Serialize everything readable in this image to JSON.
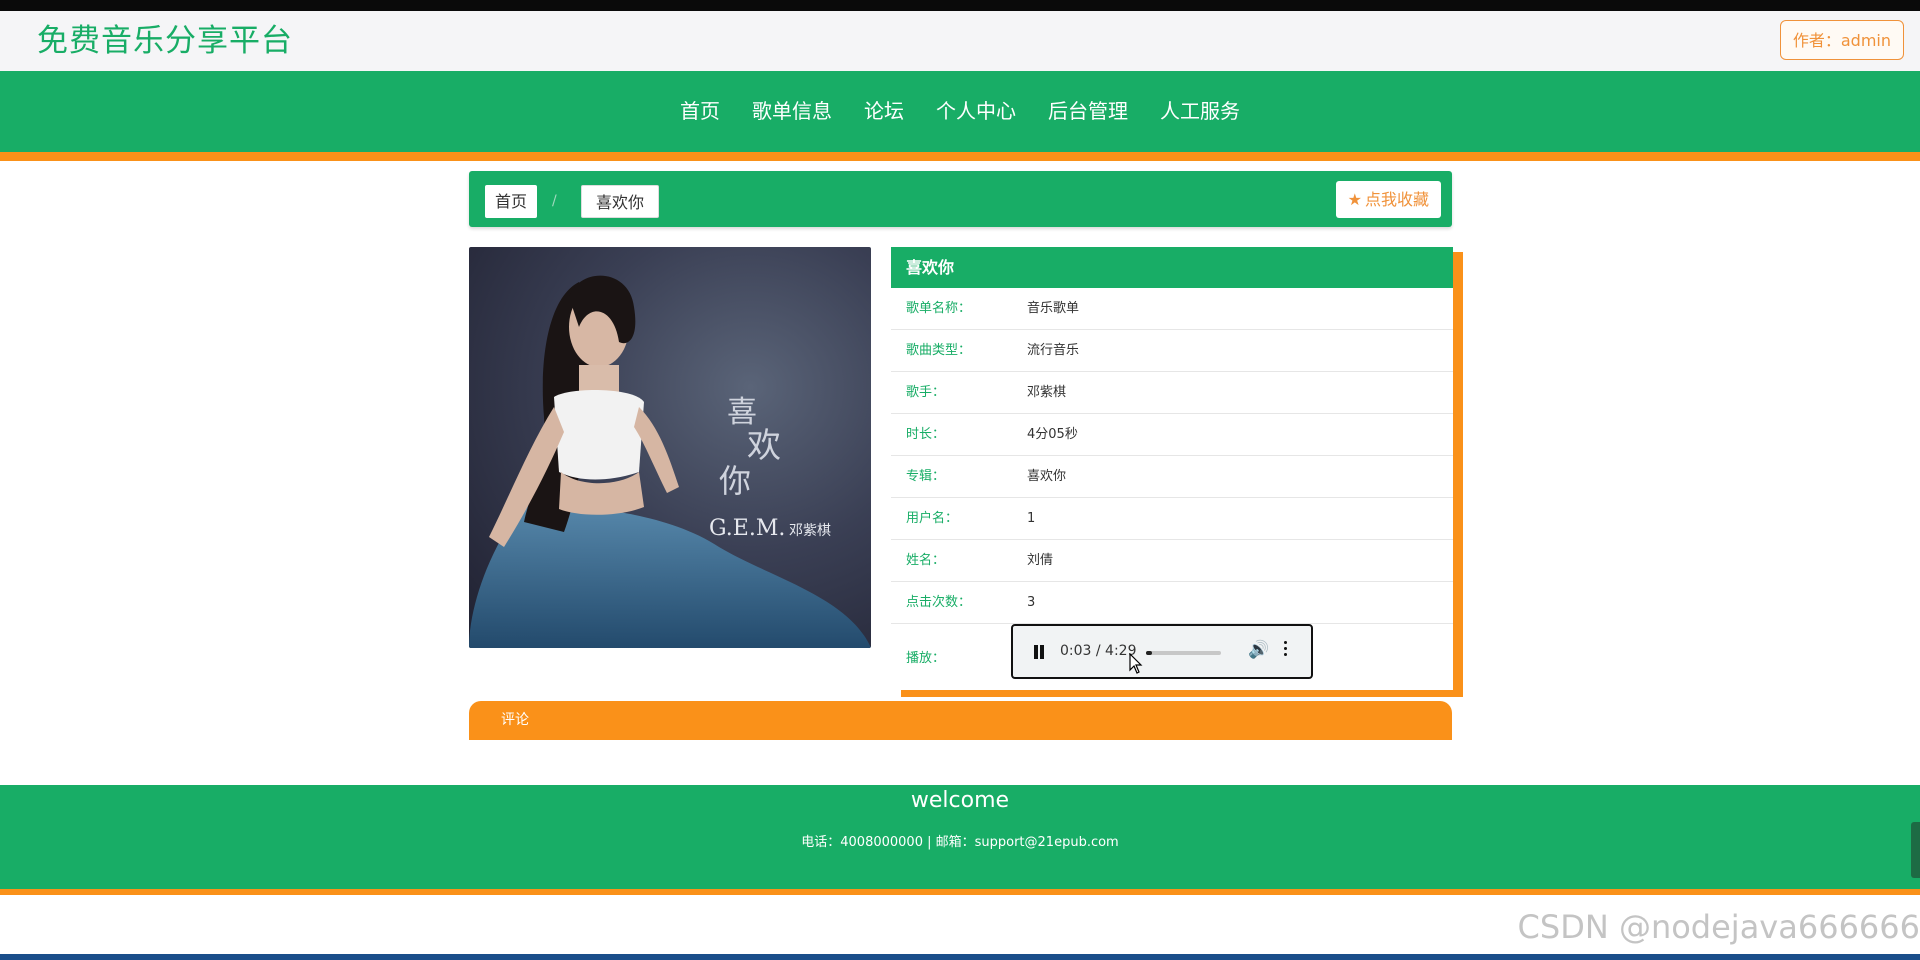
{
  "site": {
    "title": "免费音乐分享平台",
    "author_label": "作者：admin"
  },
  "nav": {
    "items": [
      "首页",
      "歌单信息",
      "论坛",
      "个人中心",
      "后台管理",
      "人工服务"
    ]
  },
  "breadcrumb": {
    "home": "首页",
    "separator": "/",
    "current": "喜欢你",
    "favorite_label": "点我收藏"
  },
  "detail": {
    "title": "喜欢你",
    "fields": [
      {
        "label": "歌单名称：",
        "value": "音乐歌单"
      },
      {
        "label": "歌曲类型：",
        "value": "流行音乐"
      },
      {
        "label": "歌手：",
        "value": "邓紫棋"
      },
      {
        "label": "时长：",
        "value": "4分05秒"
      },
      {
        "label": "专辑：",
        "value": "喜欢你"
      },
      {
        "label": "用户名：",
        "value": "1"
      },
      {
        "label": "姓名：",
        "value": "刘倩"
      },
      {
        "label": "点击次数：",
        "value": "3"
      }
    ],
    "play_label": "播放："
  },
  "player": {
    "time": "0:03 / 4:29",
    "progress_fraction": 0.012,
    "state": "playing"
  },
  "cover": {
    "line1": "喜",
    "line2": "欢",
    "line3": "你",
    "artist": "G.E.M.",
    "artist_cn": "邓紫棋"
  },
  "comment": {
    "label": "评论"
  },
  "footer": {
    "welcome": "welcome",
    "contact": "电话：4008000000 | 邮箱：support@21epub.com"
  },
  "watermark": "CSDN @nodejava666666",
  "colors": {
    "primary": "#18ad66",
    "accent": "#fa9119"
  }
}
